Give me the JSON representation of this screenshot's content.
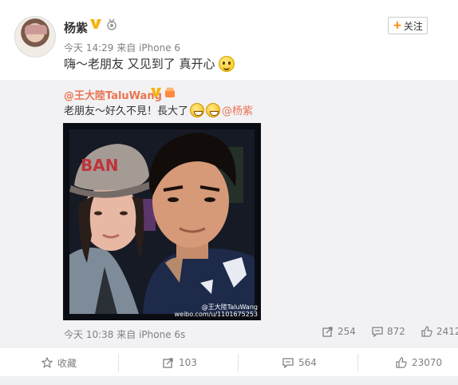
{
  "post": {
    "author": "杨紫",
    "time": "今天 14:29",
    "source_prefix": "来自",
    "source": "iPhone 6",
    "text": "嗨～老朋友 又见到了 真开心",
    "follow_label": "关注"
  },
  "repost": {
    "author": "@王大陸TaluWang",
    "text": "老朋友～好久不見！長大了",
    "mention": "@杨紫",
    "time": "今天 10:38",
    "source_prefix": "来自",
    "source": "iPhone 6s",
    "reposts": "254",
    "comments": "872",
    "likes": "2412",
    "photo_watermark_line1": "@王大陸TaluWang",
    "photo_watermark_line2": "weibo.com/u/1101675253",
    "cap_text": "BAN"
  },
  "actions": {
    "favorite_label": "收藏",
    "repost_count": "103",
    "comment_count": "564",
    "like_count": "23070"
  },
  "colors": {
    "accent": "#ff8200",
    "mention": "#eb7350",
    "muted": "#808080"
  }
}
